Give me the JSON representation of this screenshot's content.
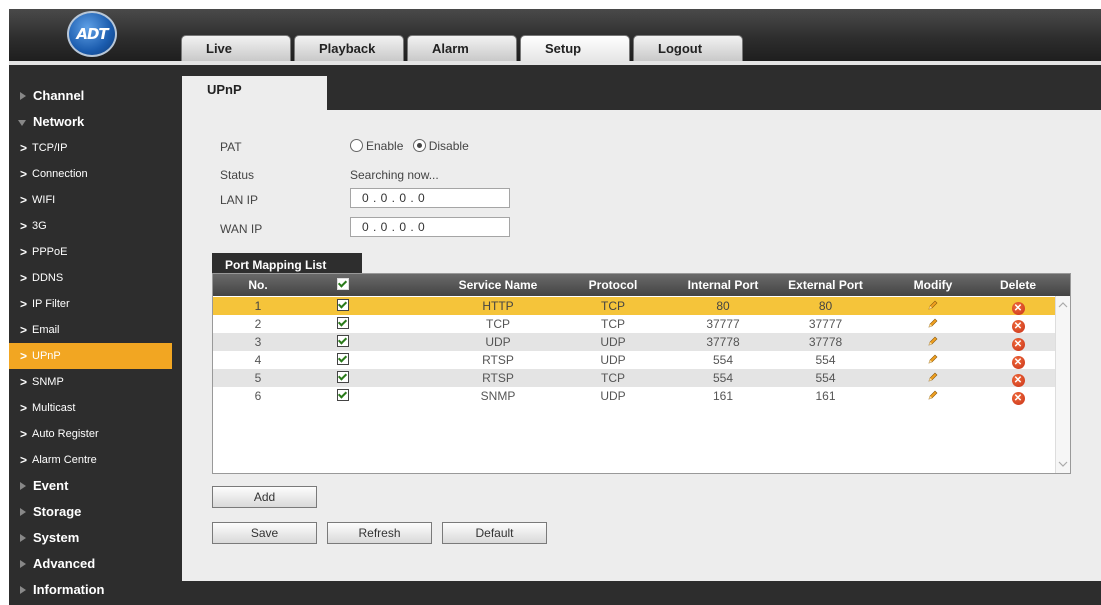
{
  "brand": {
    "logo_text": "ADT",
    "accent": "#f2a622"
  },
  "nav_tabs": [
    {
      "label": "Live"
    },
    {
      "label": "Playback"
    },
    {
      "label": "Alarm"
    },
    {
      "label": "Setup"
    },
    {
      "label": "Logout"
    }
  ],
  "sidebar": {
    "sections": [
      {
        "label": "Channel"
      },
      {
        "label": "Network"
      },
      {
        "label": "Event"
      },
      {
        "label": "Storage"
      },
      {
        "label": "System"
      },
      {
        "label": "Advanced"
      },
      {
        "label": "Information"
      }
    ],
    "network_items": [
      {
        "label": "TCP/IP"
      },
      {
        "label": "Connection"
      },
      {
        "label": "WIFI"
      },
      {
        "label": "3G"
      },
      {
        "label": "PPPoE"
      },
      {
        "label": "DDNS"
      },
      {
        "label": "IP Filter"
      },
      {
        "label": "Email"
      },
      {
        "label": "UPnP"
      },
      {
        "label": "SNMP"
      },
      {
        "label": "Multicast"
      },
      {
        "label": "Auto Register"
      },
      {
        "label": "Alarm Centre"
      }
    ]
  },
  "page": {
    "tab_label": "UPnP",
    "pat_label": "PAT",
    "enable_label": "Enable",
    "disable_label": "Disable",
    "status_label": "Status",
    "status_value": "Searching now...",
    "lan_ip_label": "LAN IP",
    "lan_ip_value": "0 . 0 . 0 . 0",
    "wan_ip_label": "WAN IP",
    "wan_ip_value": "0 . 0 . 0 . 0"
  },
  "port_mapping": {
    "title": "Port Mapping List",
    "columns": [
      "No.",
      "Service Name",
      "Protocol",
      "Internal Port",
      "External Port",
      "Modify",
      "Delete"
    ],
    "rows": [
      {
        "no": "1",
        "service": "HTTP",
        "protocol": "TCP",
        "internal": "80",
        "external": "80"
      },
      {
        "no": "2",
        "service": "TCP",
        "protocol": "TCP",
        "internal": "37777",
        "external": "37777"
      },
      {
        "no": "3",
        "service": "UDP",
        "protocol": "UDP",
        "internal": "37778",
        "external": "37778"
      },
      {
        "no": "4",
        "service": "RTSP",
        "protocol": "UDP",
        "internal": "554",
        "external": "554"
      },
      {
        "no": "5",
        "service": "RTSP",
        "protocol": "TCP",
        "internal": "554",
        "external": "554"
      },
      {
        "no": "6",
        "service": "SNMP",
        "protocol": "UDP",
        "internal": "161",
        "external": "161"
      }
    ]
  },
  "buttons": {
    "add": "Add",
    "save": "Save",
    "refresh": "Refresh",
    "default": "Default"
  }
}
